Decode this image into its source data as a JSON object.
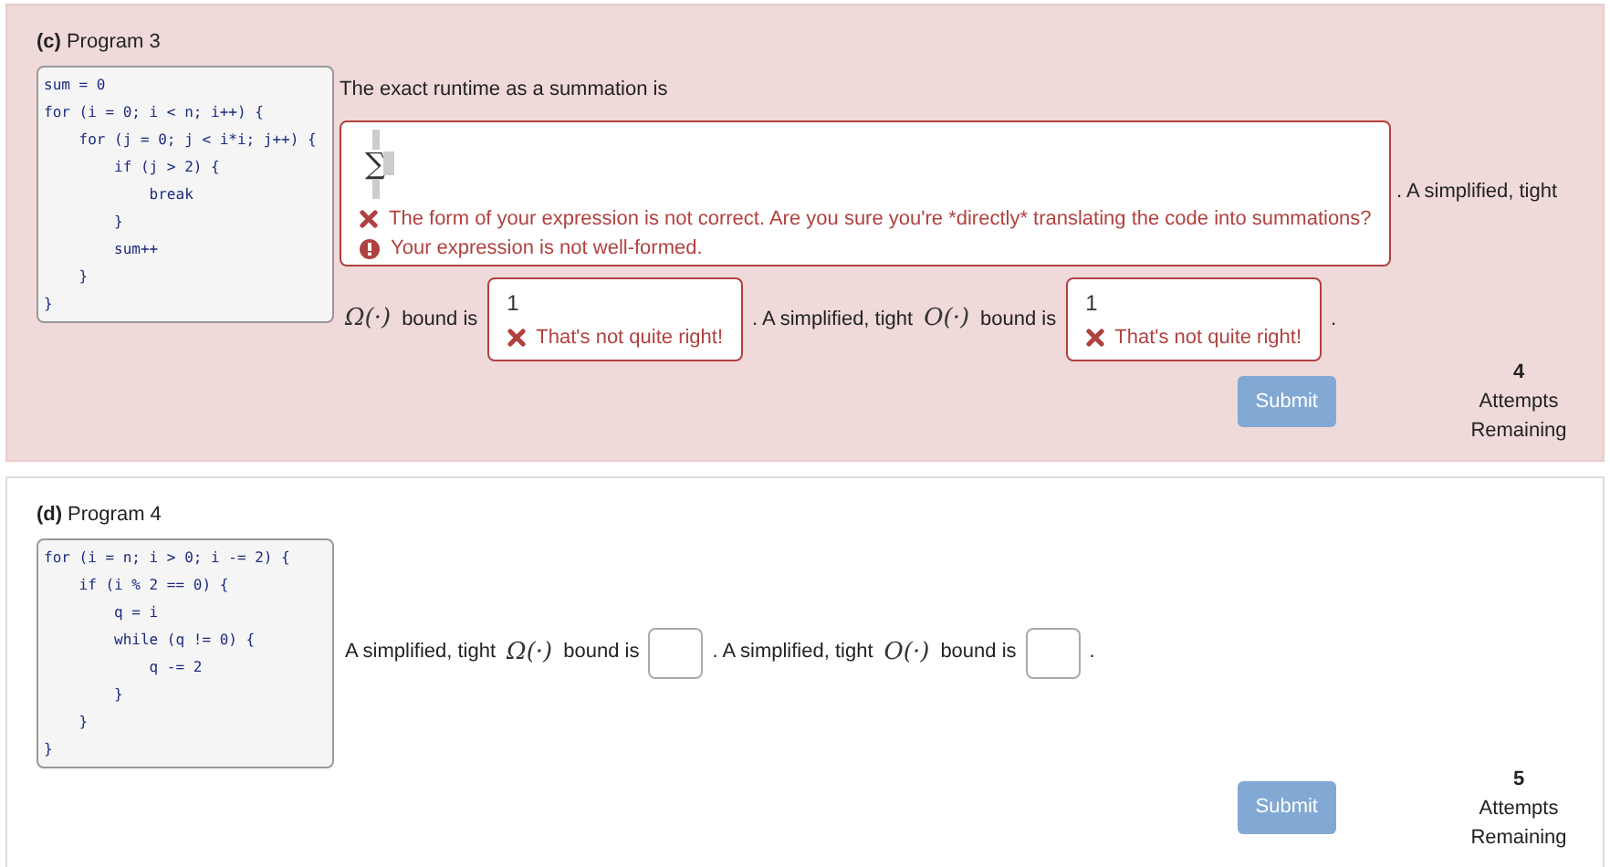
{
  "problems": [
    {
      "label": "(c)",
      "title": "Program 3",
      "incorrect": true,
      "code": [
        "sum = 0",
        "for (i = 0; i < n; i++) {",
        "    for (j = 0; j < i*i; j++) {",
        "        if (j > 2) {",
        "            break",
        "        }",
        "        sum++",
        "    }",
        "}"
      ],
      "parts": [
        {
          "kind": "prompt",
          "text": "The exact runtime as a summation is"
        },
        {
          "kind": "summation",
          "symbol": "∑",
          "feedback": [
            {
              "kind": "error",
              "text": "The form of your expression is not correct. Are you sure you're *directly* translating the code into summations?"
            },
            {
              "kind": "warning",
              "text": "Your expression is not well-formed."
            }
          ]
        },
        {
          "kind": "text",
          "text": ". A simplified, tight"
        },
        {
          "kind": "text",
          "text": "Ω(·)",
          "math": true
        },
        {
          "kind": "text",
          "text": "bound is"
        },
        {
          "kind": "answer",
          "value": "1",
          "feedback": [
            {
              "kind": "error",
              "text": "That's not quite right!"
            }
          ]
        },
        {
          "kind": "text",
          "text": ". A simplified, tight"
        },
        {
          "kind": "text",
          "text": "O(·)",
          "math": true
        },
        {
          "kind": "text",
          "text": "bound is"
        },
        {
          "kind": "answer",
          "value": "1",
          "feedback": [
            {
              "kind": "error",
              "text": "That's not quite right!"
            }
          ]
        },
        {
          "kind": "text",
          "text": "."
        }
      ],
      "submit": {
        "label": "Submit",
        "disabled": true
      },
      "attempts": {
        "count": "4",
        "label": "Attempts Remaining"
      }
    },
    {
      "label": "(d)",
      "title": "Program 4",
      "incorrect": false,
      "code": [
        "for (i = n; i > 0; i -= 2) {",
        "    if (i % 2 == 0) {",
        "        q = i",
        "        while (q != 0) {",
        "            q -= 2",
        "        }",
        "    }",
        "}"
      ],
      "parts": [
        {
          "kind": "text",
          "text": "A simplified, tight"
        },
        {
          "kind": "text",
          "text": "Ω(·)",
          "math": true
        },
        {
          "kind": "text",
          "text": "bound is"
        },
        {
          "kind": "answer"
        },
        {
          "kind": "text",
          "text": ". A simplified, tight"
        },
        {
          "kind": "text",
          "text": "O(·)",
          "math": true
        },
        {
          "kind": "text",
          "text": "bound is"
        },
        {
          "kind": "answer"
        },
        {
          "kind": "text",
          "text": "."
        }
      ],
      "submit": {
        "label": "Submit",
        "disabled": true
      },
      "attempts": {
        "count": "5",
        "label": "Attempts Remaining"
      }
    }
  ]
}
